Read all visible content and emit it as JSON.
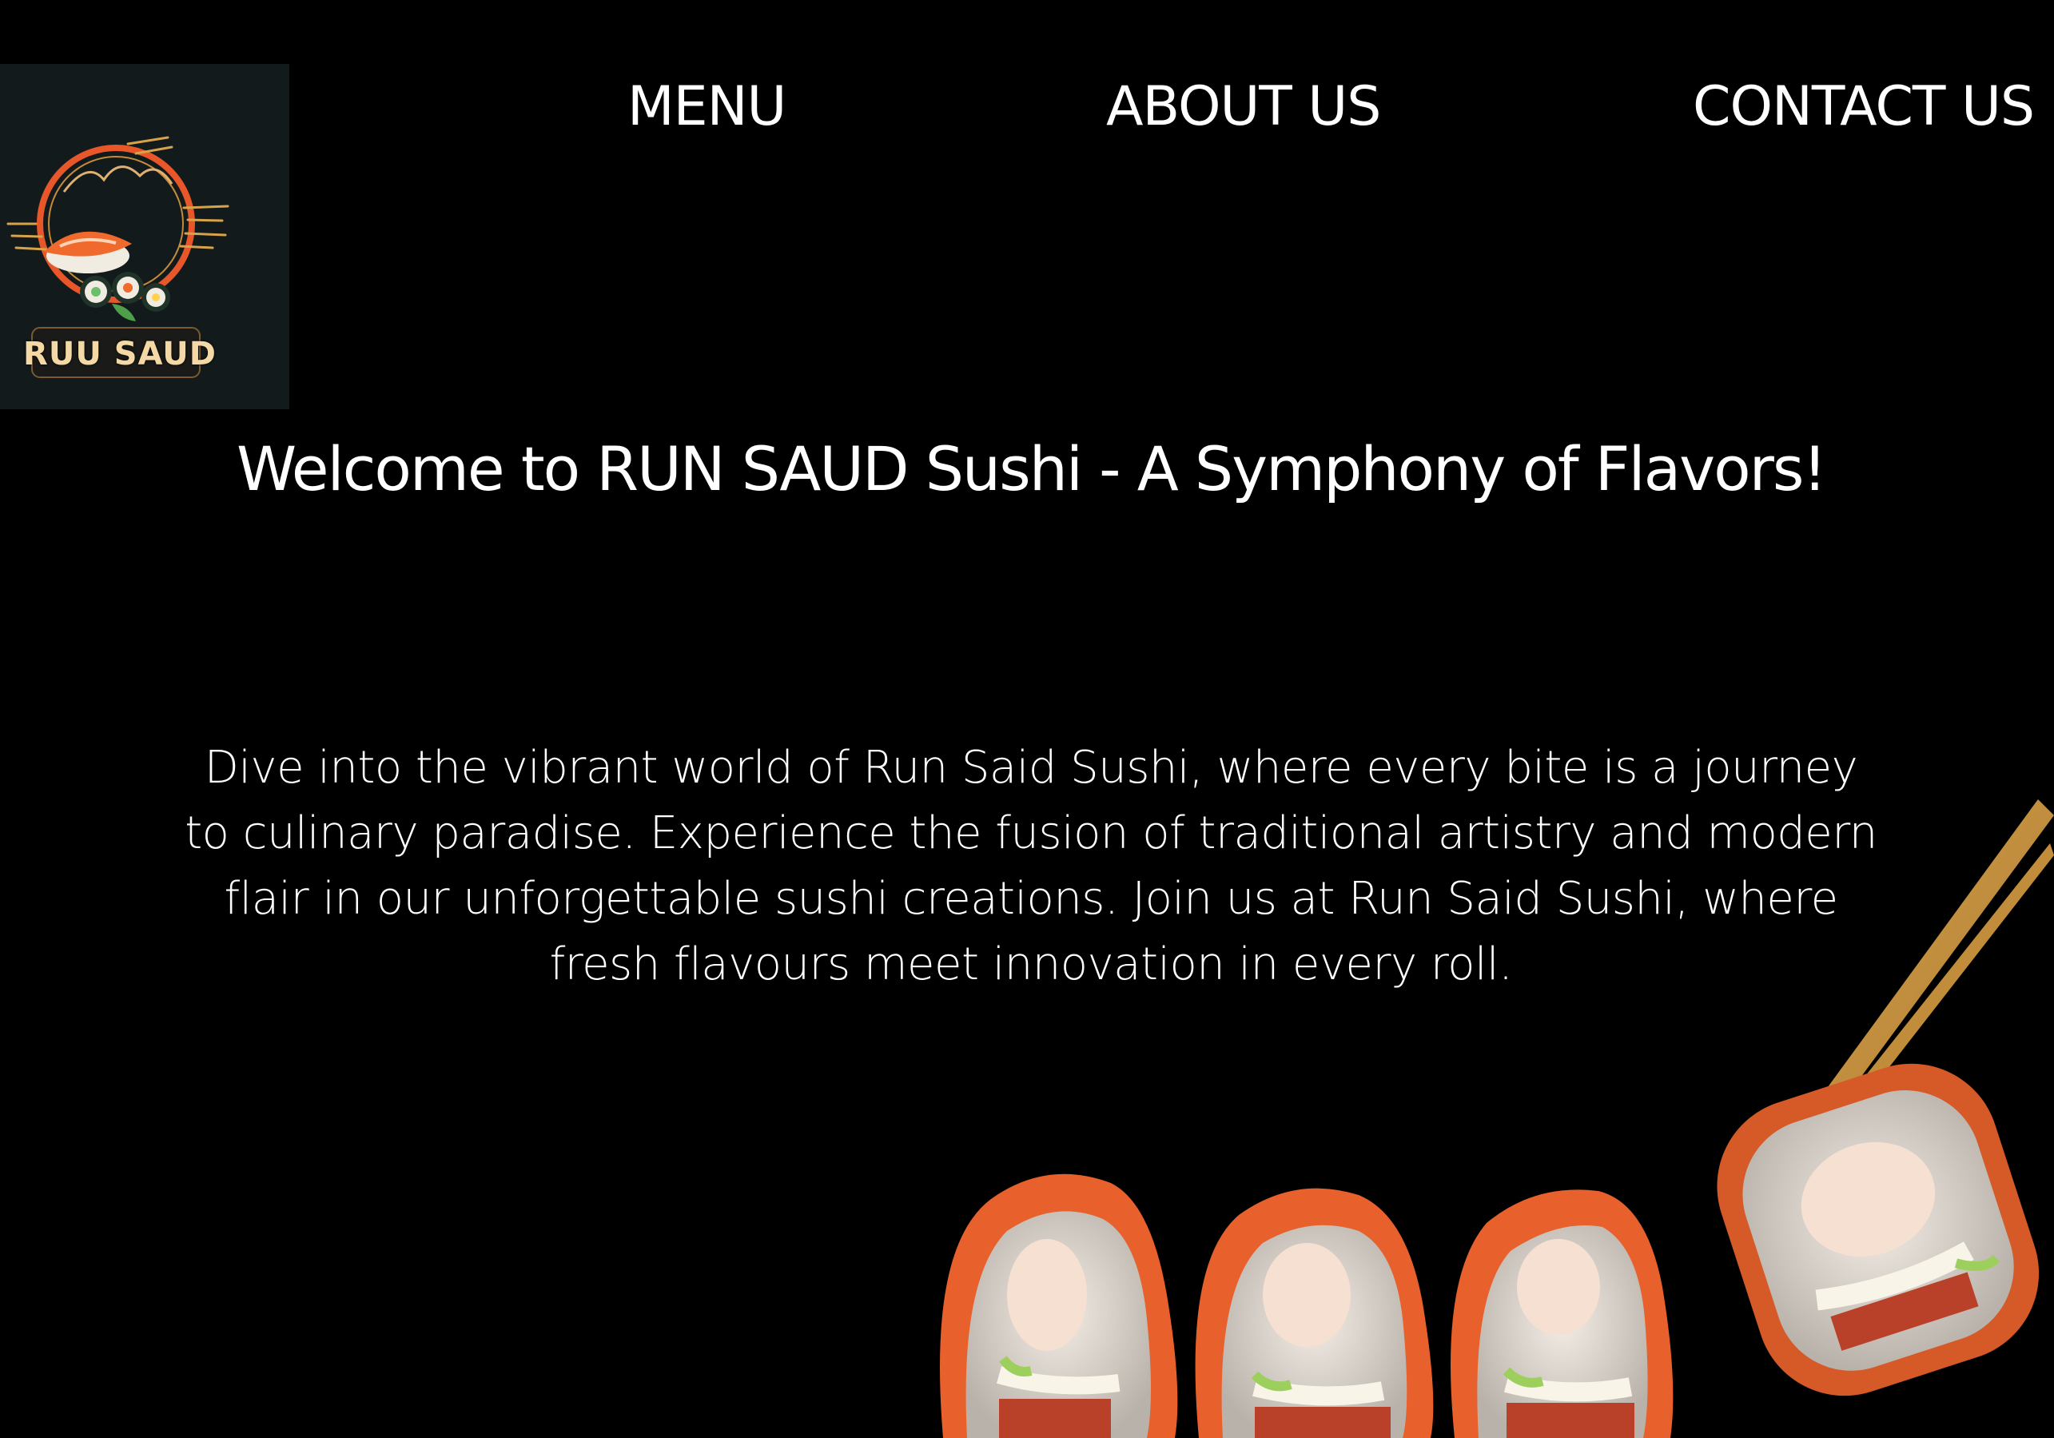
{
  "brand": {
    "logo_text": "RUU SAUD",
    "colors": {
      "background": "#000000",
      "logo_bg": "#121a1c",
      "accent_orange": "#e8572a",
      "logo_text": "#f4d9a6"
    }
  },
  "nav": {
    "items": [
      {
        "label": "MENU"
      },
      {
        "label": "ABOUT US"
      },
      {
        "label": "CONTACT US"
      }
    ]
  },
  "hero": {
    "title": "Welcome to RUN SAUD Sushi - A Symphony of Flavors!",
    "description": "Dive into the vibrant world of Run Said Sushi, where every bite is a journey to culinary paradise. Experience the fusion of traditional artistry and modern flair in our unforgettable sushi creations. Join us at Run Said Sushi, where fresh flavours meet innovation in every roll."
  },
  "decor": {
    "image": "sushi-rolls-with-chopsticks"
  }
}
